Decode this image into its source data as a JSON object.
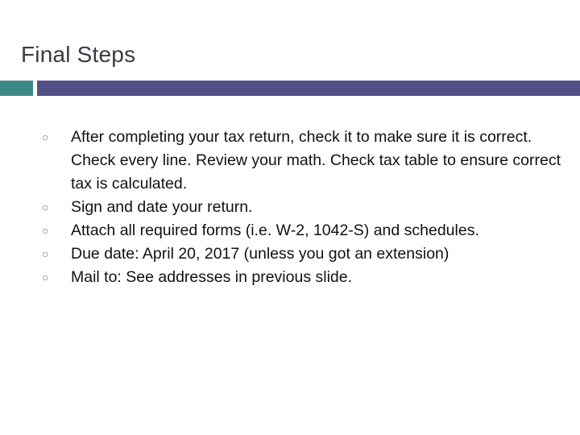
{
  "slide": {
    "title": "Final Steps",
    "accent_colors": {
      "teal": "#3e8a86",
      "purple": "#525084"
    },
    "bullet_icon": "hollow-circle",
    "bullets": [
      {
        "text": "After completing your tax return, check it to make sure it is correct.  Check every line.  Review  your math.  Check tax table to ensure correct tax is calculated."
      },
      {
        "text": "Sign and date your return."
      },
      {
        "text": "Attach all required forms (i.e. W-2, 1042-S) and schedules."
      },
      {
        "text": "Due date:  April 20, 2017 (unless you got an extension)"
      },
      {
        "text": "Mail to:  See addresses in previous slide."
      }
    ]
  }
}
